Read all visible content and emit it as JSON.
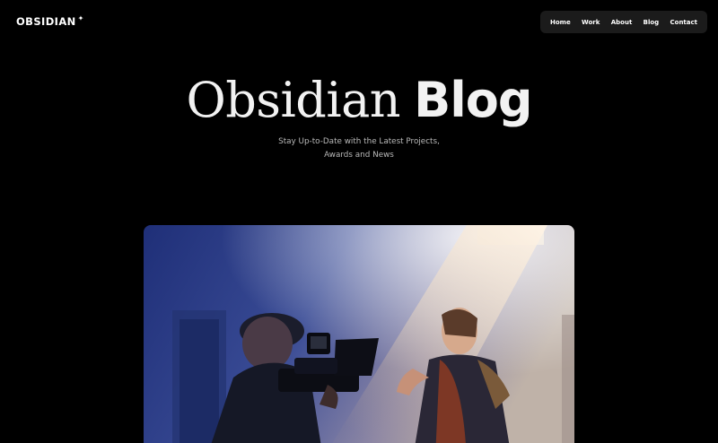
{
  "header": {
    "logo": "OBSIDIAN",
    "logo_mark": "✦"
  },
  "nav": {
    "items": [
      {
        "label": "Home"
      },
      {
        "label": "Work"
      },
      {
        "label": "About"
      },
      {
        "label": "Blog"
      },
      {
        "label": "Contact"
      }
    ]
  },
  "hero": {
    "title_light": "Obsidian",
    "title_bold": "Blog",
    "subtitle_line1": "Stay Up-to-Date with the Latest Projects,",
    "subtitle_line2": "Awards and News"
  },
  "colors": {
    "background": "#000000",
    "nav_bg": "#1b1b1b",
    "text": "#ffffff",
    "subtext": "#b9b9b9",
    "image_blue": "#2c3f8c",
    "image_light": "#e6d6c6"
  }
}
